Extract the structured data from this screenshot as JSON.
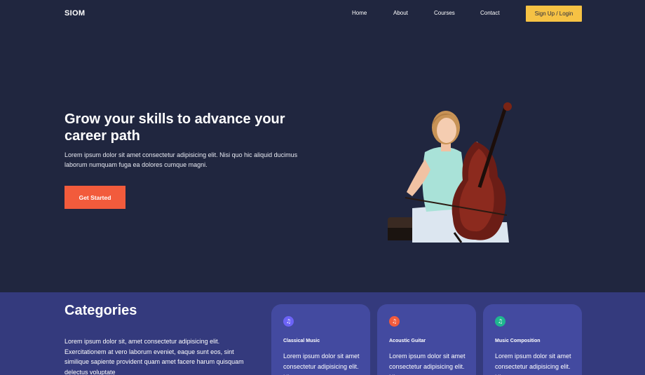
{
  "header": {
    "logo": "SIOM",
    "nav": [
      "Home",
      "About",
      "Courses",
      "Contact"
    ],
    "signup": "Sign Up / Login"
  },
  "hero": {
    "title": "Grow your skills to advance your career path",
    "text": "Lorem ipsum dolor sit amet consectetur adipisicing elit. Nisi quo hic aliquid ducimus laborum numquam fuga ea dolores cumque magni.",
    "button": "Get Started"
  },
  "categories": {
    "title": "Categories",
    "text": "Lorem ipsum dolor sit, amet consectetur adipisicing elit. Exercitationem at vero laborum eveniet, eaque sunt eos, sint similique sapiente provident quam amet facere harum quisquam delectus voluptate",
    "cards": [
      {
        "title": "Classical Music",
        "text": "Lorem ipsum dolor sit amet consectetur adipisicing elit. Hic",
        "icon": "music-note-icon",
        "color": "#6c63f6"
      },
      {
        "title": "Acoustic Guitar",
        "text": "Lorem ipsum dolor sit amet consectetur adipisicing elit. Hic",
        "icon": "music-note-icon",
        "color": "#f25b3c"
      },
      {
        "title": "Music Composition",
        "text": "Lorem ipsum dolor sit amet consectetur adipisicing elit. Hic",
        "icon": "music-note-icon",
        "color": "#1fb68f"
      }
    ]
  },
  "colors": {
    "background": "#20263f",
    "accent_yellow": "#f6c244",
    "accent_orange": "#f25b3c",
    "section": "#343a7d",
    "card": "#434aa0"
  }
}
